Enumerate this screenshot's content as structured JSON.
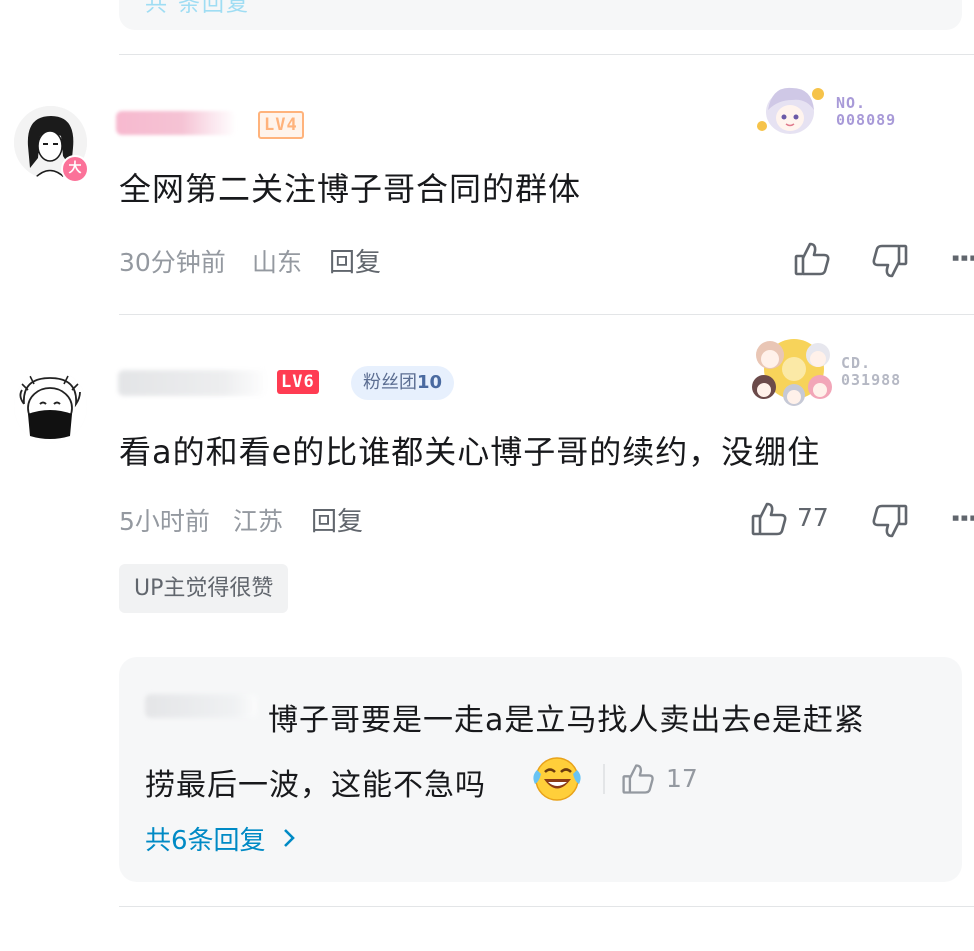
{
  "top_partial": {
    "link_text": "共 条回复"
  },
  "comments": [
    {
      "level": "LV4",
      "avatar_badge": "大",
      "decoration_number": "NO.\n008089",
      "content": "全网第二关注博子哥合同的群体",
      "time": "30分钟前",
      "location": "山东",
      "reply_label": "回复",
      "like_count": "",
      "icons": [
        "thumb-up-icon",
        "thumb-down-icon",
        "more-icon"
      ]
    },
    {
      "level": "LV6",
      "fans_club": {
        "label": "粉丝团",
        "level": "10"
      },
      "decoration_number": "CD.\n031988",
      "content": "看a的和看e的比谁都关心博子哥的续约，没绷住",
      "time": "5小时前",
      "location": "江苏",
      "reply_label": "回复",
      "like_count": "77",
      "up_badge": "UP主觉得很赞",
      "reply_preview": {
        "line1": "博子哥要是一走a是立马找人卖出去e是赶紧",
        "line2": "捞最后一波，这能不急吗",
        "emoji": "laughing-crying-emoji",
        "like_count": "17",
        "more_replies": "共6条回复"
      }
    }
  ],
  "colors": {
    "accent_link": "#008ac5",
    "lv6_bg": "#ff3c52",
    "lv4": "#ffb37c",
    "meta_text": "#9499a0",
    "divider": "#e3e5e7"
  }
}
